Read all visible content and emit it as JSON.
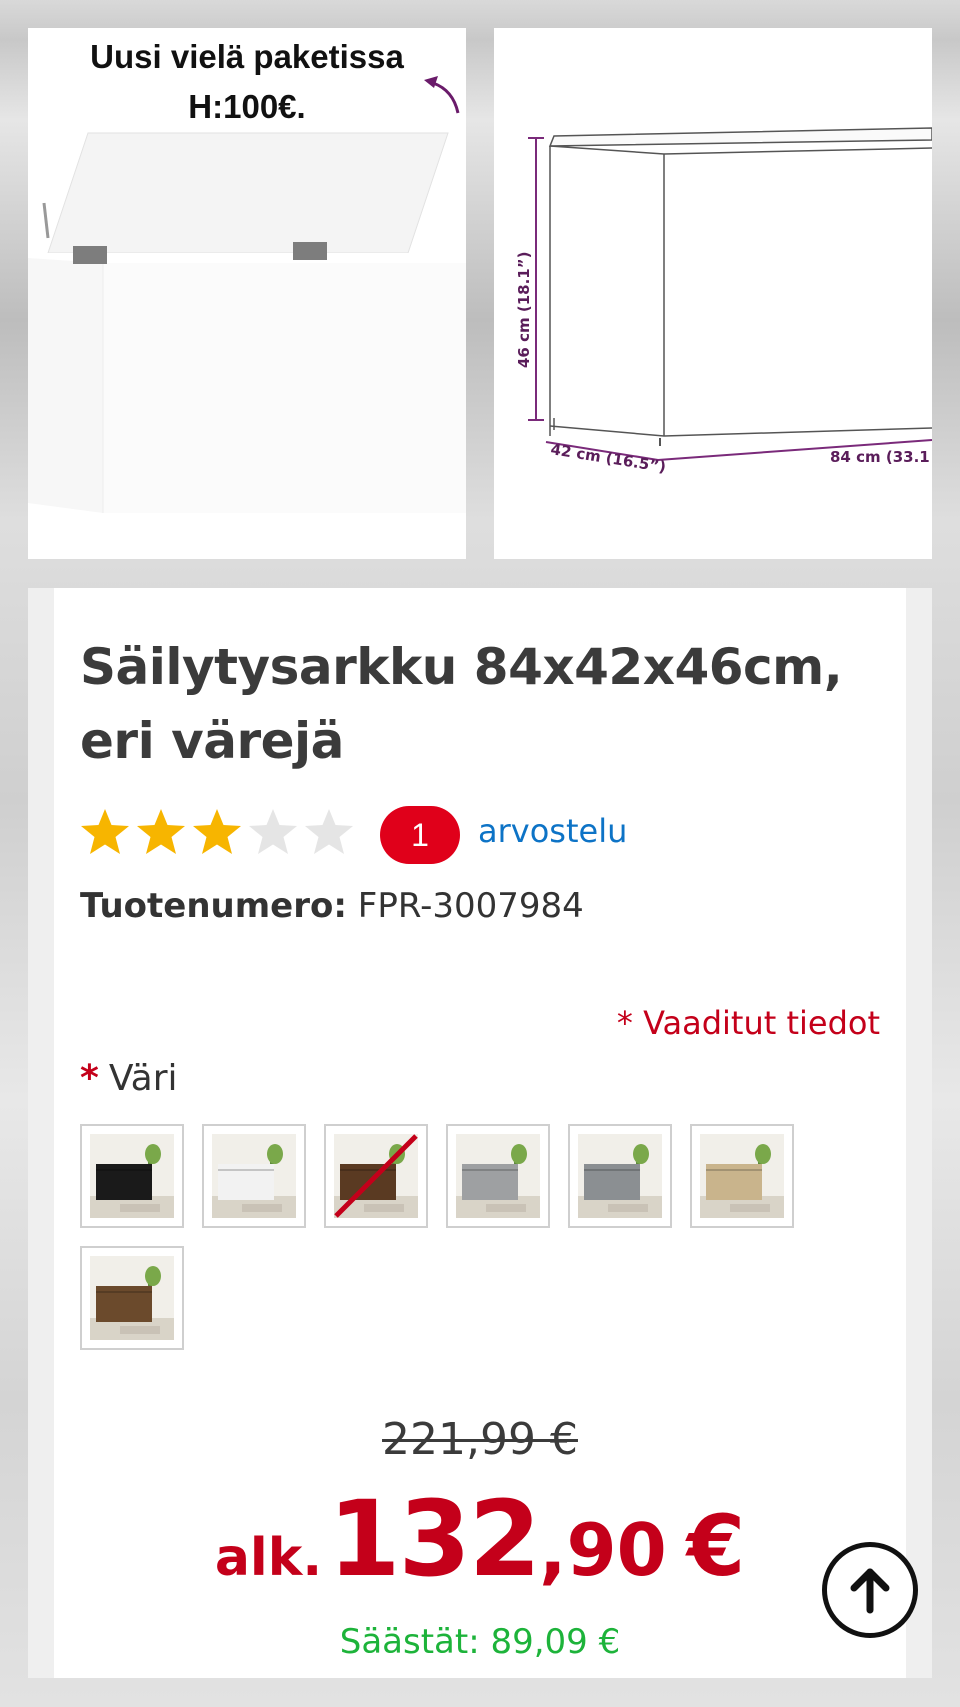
{
  "gallery": {
    "left_overlay_lines": [
      "Uusi vielä paketissa",
      "H:100€."
    ],
    "dimension_labels": {
      "height": "46 cm (18.1”)",
      "depth": "42 cm (16.5”)",
      "width": "84 cm (33.1"
    }
  },
  "product": {
    "title_lines": [
      "Säilytysarkku 84x42x46cm,",
      "eri värejä"
    ],
    "rating": {
      "value": 3,
      "max": 5
    },
    "review_count": "1",
    "review_link": "arvostelu",
    "sku_label": "Tuotenumero:",
    "sku_value": "FPR-3007984"
  },
  "options": {
    "required_note": "* Vaaditut tiedot",
    "color_asterisk": "*",
    "color_label": "Väri",
    "swatches": [
      {
        "name": "black",
        "color": "#1a1a1a",
        "unavailable": false
      },
      {
        "name": "white",
        "color": "#f2f2f2",
        "unavailable": false
      },
      {
        "name": "smoked-oak",
        "color": "#5a3a22",
        "unavailable": true
      },
      {
        "name": "concrete-grey",
        "color": "#9ea0a2",
        "unavailable": false
      },
      {
        "name": "grey-sonoma",
        "color": "#8b8f92",
        "unavailable": false
      },
      {
        "name": "sonoma-oak",
        "color": "#c9b48c",
        "unavailable": false
      },
      {
        "name": "old-wood",
        "color": "#6b4a2c",
        "unavailable": false
      }
    ]
  },
  "pricing": {
    "old_price": "221,99 €",
    "prefix": "alk.",
    "price_integer": "132",
    "price_decimal": ",90",
    "currency": "€",
    "savings": "Säästät: 89,09 €"
  },
  "colors": {
    "accent_red": "#c4001a",
    "link_blue": "#0d73c6",
    "savings_green": "#1db33a",
    "star_gold": "#f7b500",
    "star_empty": "#e5e5e5"
  },
  "icons": {
    "scroll_top": "arrow-up-circle-icon"
  }
}
